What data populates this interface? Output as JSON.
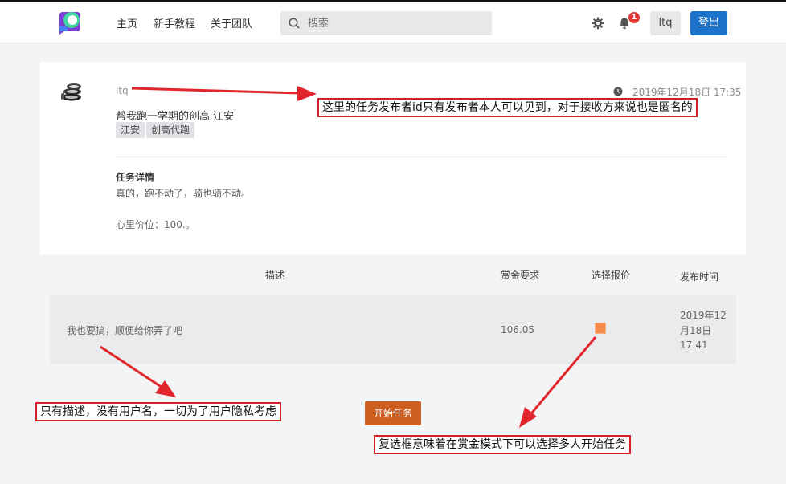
{
  "nav": {
    "links": [
      "主页",
      "新手教程",
      "关于团队"
    ],
    "search_placeholder": "搜索",
    "notification_count": "1",
    "user_label": "ltq",
    "login_label": "登出"
  },
  "task": {
    "publisher": "ltq",
    "title": "帮我跑一学期的创高 江安",
    "tags": [
      "江安",
      "创高代跑"
    ],
    "published_at": "2019年12月18日 17:35",
    "detail_heading": "任务详情",
    "detail_text": "真的，跑不动了，骑也骑不动。",
    "detail_price": "心里价位：100.。"
  },
  "table": {
    "headers": [
      "描述",
      "赏金要求",
      "选择报价",
      "发布时间"
    ],
    "rows": [
      {
        "description": "我也要搞，顺便给你弄了吧",
        "bounty": "106.05",
        "time_lines": [
          "2019年12",
          "月18日",
          "17:41"
        ]
      }
    ]
  },
  "start_button": "开始任务",
  "annotations": [
    "这里的任务发布者id只有发布者本人可以见到，对于接收方来说也是匿名的",
    "只有描述，没有用户名，一切为了用户隐私考虑",
    "复选框意味着在赏金模式下可以选择多人开始任务"
  ],
  "colors": {
    "login_button": "#1d72c9",
    "start_button": "#cd5f22",
    "checkbox": "#f58a4a",
    "annotation_red": "#d32027",
    "badge": "#e53935"
  }
}
